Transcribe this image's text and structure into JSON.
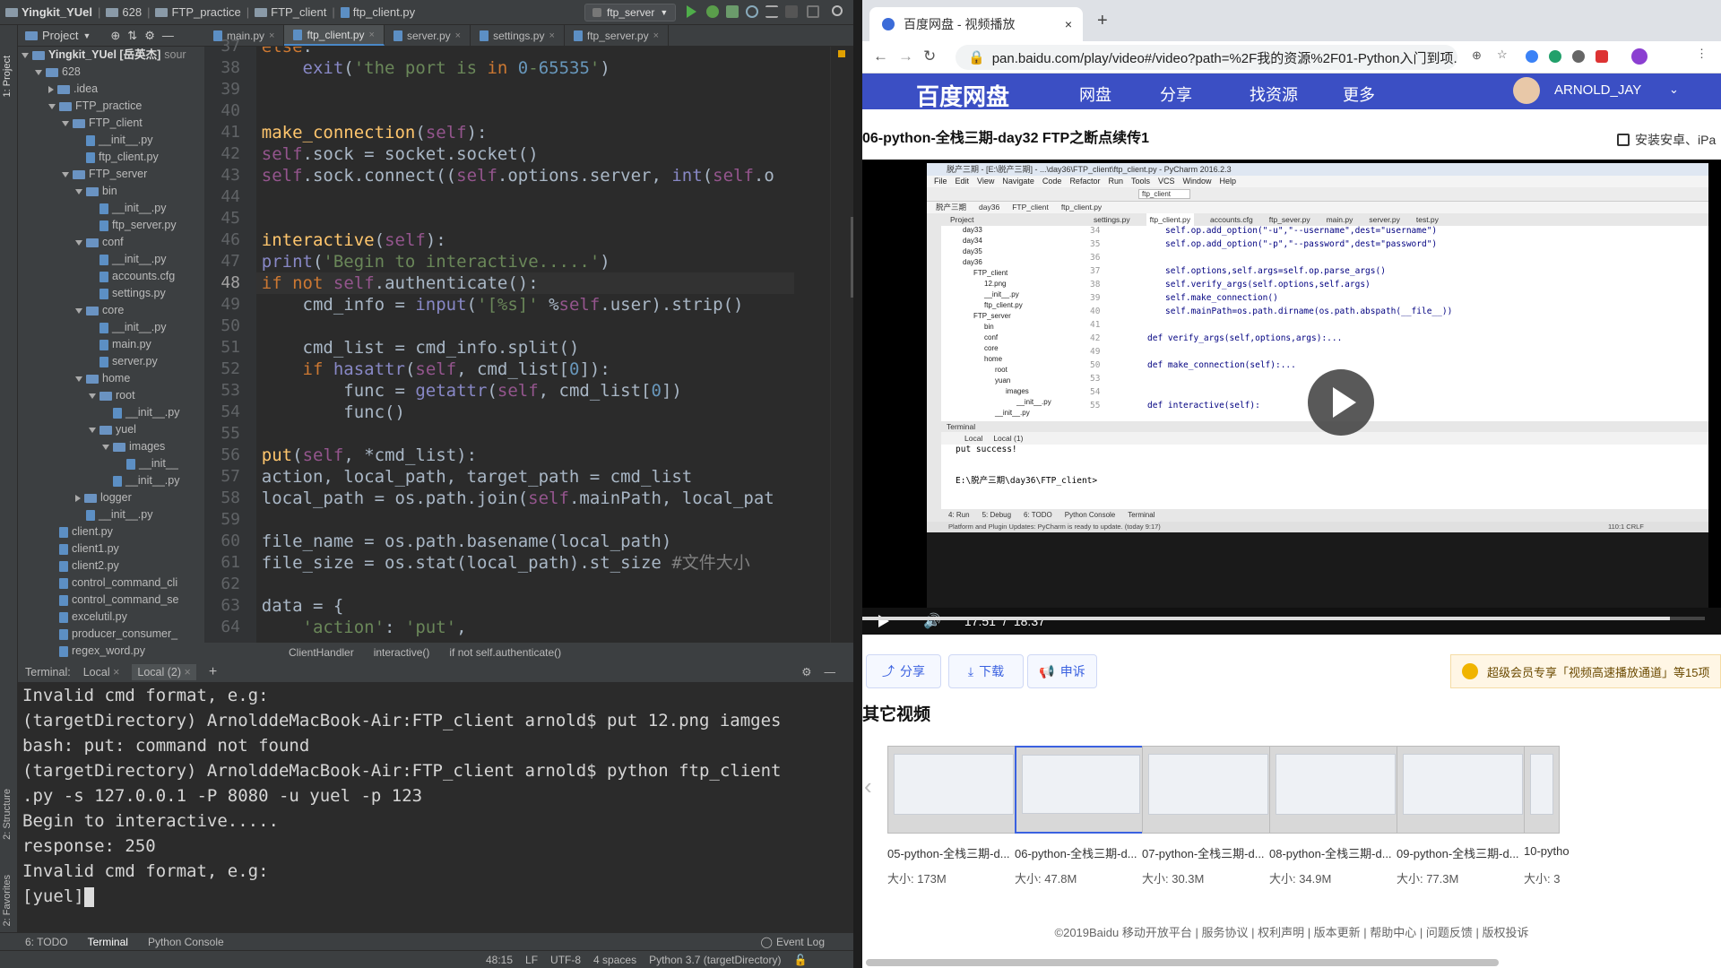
{
  "ide": {
    "breadcrumb": [
      "Yingkit_YUel",
      "628",
      "FTP_practice",
      "FTP_client",
      "ftp_client.py"
    ],
    "run_config": "ftp_server",
    "left_strip": {
      "project": "1: Project",
      "structure": "2: Structure",
      "favorites": "2: Favorites"
    },
    "project_header": "Project",
    "tree": [
      {
        "label": "Yingkit_YUel [岳英杰]",
        "extra": "sour",
        "depth": 0,
        "type": "folder",
        "open": true
      },
      {
        "label": "628",
        "depth": 1,
        "type": "folder",
        "open": true
      },
      {
        "label": ".idea",
        "depth": 2,
        "type": "folder",
        "open": false
      },
      {
        "label": "FTP_practice",
        "depth": 2,
        "type": "folder",
        "open": true
      },
      {
        "label": "FTP_client",
        "depth": 3,
        "type": "folder",
        "open": true
      },
      {
        "label": "__init__.py",
        "depth": 4,
        "type": "file"
      },
      {
        "label": "ftp_client.py",
        "depth": 4,
        "type": "file"
      },
      {
        "label": "FTP_server",
        "depth": 3,
        "type": "folder",
        "open": true
      },
      {
        "label": "bin",
        "depth": 4,
        "type": "folder",
        "open": true
      },
      {
        "label": "__init__.py",
        "depth": 5,
        "type": "file"
      },
      {
        "label": "ftp_server.py",
        "depth": 5,
        "type": "file"
      },
      {
        "label": "conf",
        "depth": 4,
        "type": "folder",
        "open": true
      },
      {
        "label": "__init__.py",
        "depth": 5,
        "type": "file"
      },
      {
        "label": "accounts.cfg",
        "depth": 5,
        "type": "file"
      },
      {
        "label": "settings.py",
        "depth": 5,
        "type": "file"
      },
      {
        "label": "core",
        "depth": 4,
        "type": "folder",
        "open": true
      },
      {
        "label": "__init__.py",
        "depth": 5,
        "type": "file"
      },
      {
        "label": "main.py",
        "depth": 5,
        "type": "file"
      },
      {
        "label": "server.py",
        "depth": 5,
        "type": "file"
      },
      {
        "label": "home",
        "depth": 4,
        "type": "folder",
        "open": true
      },
      {
        "label": "root",
        "depth": 5,
        "type": "folder",
        "open": true
      },
      {
        "label": "__init__.py",
        "depth": 6,
        "type": "file"
      },
      {
        "label": "yuel",
        "depth": 5,
        "type": "folder",
        "open": true
      },
      {
        "label": "images",
        "depth": 6,
        "type": "folder",
        "open": true
      },
      {
        "label": "__init__",
        "depth": 7,
        "type": "file"
      },
      {
        "label": "__init__.py",
        "depth": 6,
        "type": "file"
      },
      {
        "label": "logger",
        "depth": 4,
        "type": "folder",
        "open": false
      },
      {
        "label": "__init__.py",
        "depth": 4,
        "type": "file"
      },
      {
        "label": "client.py",
        "depth": 2,
        "type": "file"
      },
      {
        "label": "client1.py",
        "depth": 2,
        "type": "file"
      },
      {
        "label": "client2.py",
        "depth": 2,
        "type": "file"
      },
      {
        "label": "control_command_cli",
        "depth": 2,
        "type": "file"
      },
      {
        "label": "control_command_se",
        "depth": 2,
        "type": "file"
      },
      {
        "label": "excelutil.py",
        "depth": 2,
        "type": "file"
      },
      {
        "label": "producer_consumer_",
        "depth": 2,
        "type": "file"
      },
      {
        "label": "regex_word.py",
        "depth": 2,
        "type": "file"
      }
    ],
    "tabs": [
      {
        "label": "main.py",
        "active": false
      },
      {
        "label": "ftp_client.py",
        "active": true
      },
      {
        "label": "server.py",
        "active": false
      },
      {
        "label": "settings.py",
        "active": false
      },
      {
        "label": "ftp_server.py",
        "active": false
      }
    ],
    "line_numbers": [
      "37",
      "38",
      "39",
      "40",
      "41",
      "42",
      "43",
      "44",
      "45",
      "46",
      "47",
      "48",
      "49",
      "50",
      "51",
      "52",
      "53",
      "54",
      "55",
      "56",
      "57",
      "58",
      "59",
      "60",
      "61",
      "62",
      "63",
      "64"
    ],
    "code_lines": [
      "    else:",
      "        exit('the port is in 0-65535')",
      "",
      "",
      "def make_connection(self):",
      "    self.sock = socket.socket()",
      "    self.sock.connect((self.options.server, int(self.o",
      "",
      "",
      "def interactive(self):",
      "    print('Begin to interactive.....')",
      "    if not self.authenticate():",
      "        cmd_info = input('[%s]' %self.user).strip()",
      "",
      "        cmd_list = cmd_info.split()",
      "        if hasattr(self, cmd_list[0]):",
      "            func = getattr(self, cmd_list[0])",
      "            func()",
      "",
      "def put(self, *cmd_list):",
      "    action, local_path, target_path = cmd_list",
      "    local_path = os.path.join(self.mainPath, local_pat",
      "",
      "    file_name = os.path.basename(local_path)",
      "    file_size = os.stat(local_path).st_size #文件大小",
      "",
      "    data = {",
      "        'action': 'put',"
    ],
    "editor_breadcrumb": [
      "ClientHandler",
      "interactive()",
      "if not self.authenticate()"
    ],
    "terminal_tabs": {
      "label": "Terminal:",
      "local": "Local",
      "local2": "Local (2)"
    },
    "terminal_lines": [
      "Invalid cmd format, e.g:",
      "(targetDirectory) ArnolddeMacBook-Air:FTP_client arnold$ put 12.png iamges",
      "bash: put: command not found",
      "(targetDirectory) ArnolddeMacBook-Air:FTP_client arnold$ python ftp_client",
      ".py -s 127.0.0.1 -P 8080 -u yuel -p 123",
      "Begin to interactive.....",
      "response: 250",
      "Invalid cmd format, e.g:",
      "[yuel]"
    ],
    "bottom_tabs": [
      "6: TODO",
      "Terminal",
      "Python Console"
    ],
    "event_log": "Event Log",
    "status": {
      "pos": "48:15",
      "lf": "LF",
      "enc": "UTF-8",
      "indent": "4 spaces",
      "interp": "Python 3.7 (targetDirectory)"
    }
  },
  "browser": {
    "tab_title": "百度网盘 - 视频播放",
    "url": "pan.baidu.com/play/video#/video?path=%2F我的资源%2F01-Python入门到项...",
    "nav": {
      "logo": "百度网盘",
      "items": [
        "网盘",
        "分享",
        "找资源",
        "更多"
      ],
      "user": "ARNOLD_JAY"
    },
    "video_title": "06-python-全栈三期-day32 FTP之断点续传1",
    "install_label": "安装安卓、iPa",
    "time_current": "17:51",
    "time_sep": "/",
    "time_total": "18:37",
    "progress": 0.958,
    "actions": [
      "分享",
      "下载",
      "申诉"
    ],
    "vip": "超级会员专享「视频高速播放通道」等15项",
    "other_title": "其它视频",
    "videos": [
      {
        "title": "05-python-全栈三期-d...",
        "size": "大小: 173M"
      },
      {
        "title": "06-python-全栈三期-d...",
        "size": "大小: 47.8M"
      },
      {
        "title": "07-python-全栈三期-d...",
        "size": "大小: 30.3M"
      },
      {
        "title": "08-python-全栈三期-d...",
        "size": "大小: 34.9M"
      },
      {
        "title": "09-python-全栈三期-d...",
        "size": "大小: 77.3M"
      },
      {
        "title": "10-pytho",
        "size": "大小: 3"
      }
    ],
    "footer": "©2019Baidu  移动开放平台 | 服务协议 | 权利声明 | 版本更新 | 帮助中心 | 问题反馈 | 版权投诉",
    "inner": {
      "title": "脱产三期 - [E:\\脱产三期] - ...\\day36\\FTP_client\\ftp_client.py - PyCharm 2016.2.3",
      "menu": [
        "File",
        "Edit",
        "View",
        "Navigate",
        "Code",
        "Refactor",
        "Run",
        "Tools",
        "VCS",
        "Window",
        "Help"
      ],
      "run_config": "ftp_client",
      "crumbs": [
        "脱产三期",
        "day36",
        "FTP_client",
        "ftp_client.py"
      ],
      "project_label": "Project",
      "tabs": [
        "settings.py",
        "ftp_client.py",
        "accounts.cfg",
        "ftp_sever.py",
        "main.py",
        "server.py",
        "test.py"
      ],
      "tree": [
        "day33",
        "day34",
        "day35",
        "day36",
        "FTP_client",
        "12.png",
        "__init__.py",
        "ftp_client.py",
        "FTP_server",
        "bin",
        "conf",
        "core",
        "home",
        "root",
        "yuan",
        "images",
        "__init__.py",
        "__init__.py"
      ],
      "line_numbers": [
        "34",
        "35",
        "36",
        "37",
        "38",
        "39",
        "40",
        "41",
        "42",
        "49",
        "50",
        "53",
        "54",
        "55"
      ],
      "code": [
        "self.op.add_option(\"-u\",\"--username\",dest=\"username\")",
        "self.op.add_option(\"-p\",\"--password\",dest=\"password\")",
        "",
        "self.options,self.args=self.op.parse_args()",
        "self.verify_args(self.options,self.args)",
        "self.make_connection()",
        "self.mainPath=os.path.dirname(os.path.abspath(__file__))",
        "",
        "def verify_args(self,options,args):...",
        "",
        "def make_connection(self):...",
        "",
        "",
        "def interactive(self):"
      ],
      "terminal_label": "Terminal",
      "terminal_tabs": [
        "Local",
        "Local (1)"
      ],
      "terminal_lines": [
        "put success!",
        "",
        "E:\\脱产三期\\day36\\FTP_client>"
      ],
      "bottom_tabs": [
        "4: Run",
        "5: Debug",
        "6: TODO",
        "Python Console",
        "Terminal"
      ],
      "status": "Platform and Plugin Updates: PyCharm is ready to update. (today 9:17)",
      "status_right": "110:1  CRLF"
    }
  }
}
